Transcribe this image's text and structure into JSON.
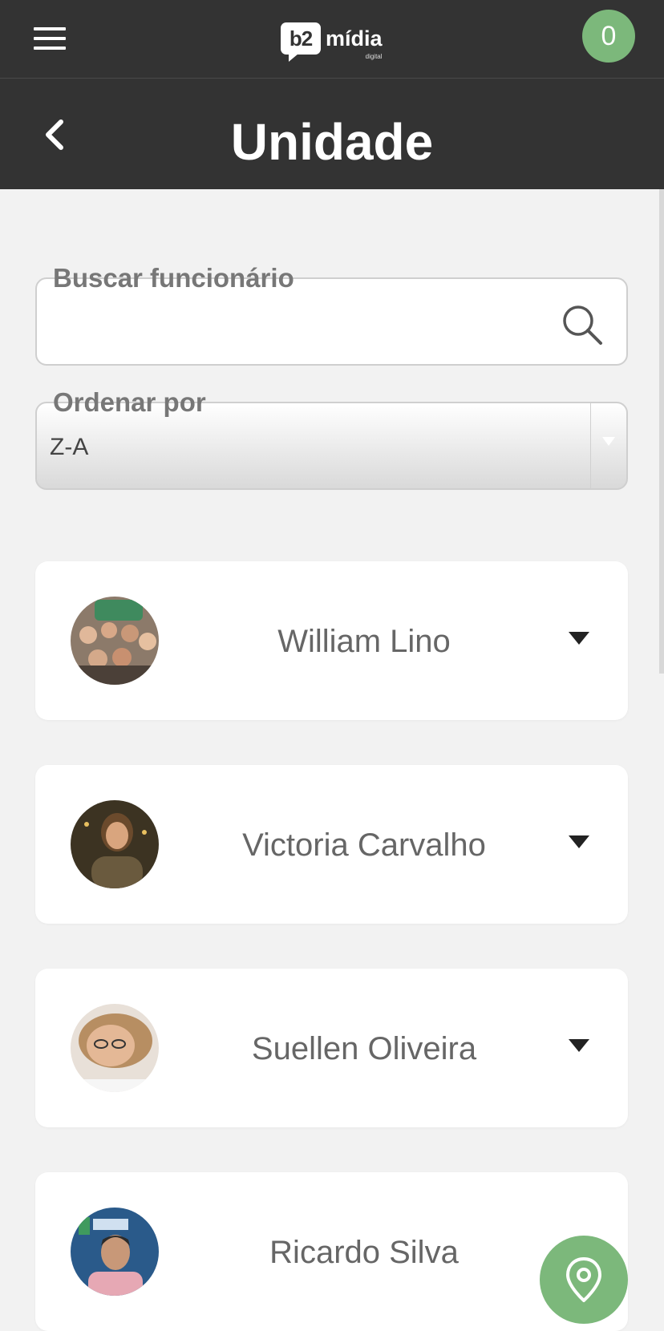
{
  "header": {
    "logo": {
      "mark": "b2",
      "word": "mídia",
      "sub": "digital"
    },
    "cart_count": "0",
    "page_title": "Unidade"
  },
  "search": {
    "label": "Buscar funcionário",
    "value": "",
    "placeholder": ""
  },
  "sort": {
    "label": "Ordenar por",
    "selected": "Z-A"
  },
  "employees": [
    {
      "name": "William Lino"
    },
    {
      "name": "Victoria Carvalho"
    },
    {
      "name": "Suellen Oliveira"
    },
    {
      "name": "Ricardo Silva"
    }
  ],
  "colors": {
    "header_bg": "#333333",
    "accent": "#7cb87b",
    "page_bg": "#f2f2f2"
  },
  "icons": [
    "menu-icon",
    "back-icon",
    "search-icon",
    "dropdown-arrow-icon",
    "chevron-down-icon",
    "location-pin-icon"
  ]
}
